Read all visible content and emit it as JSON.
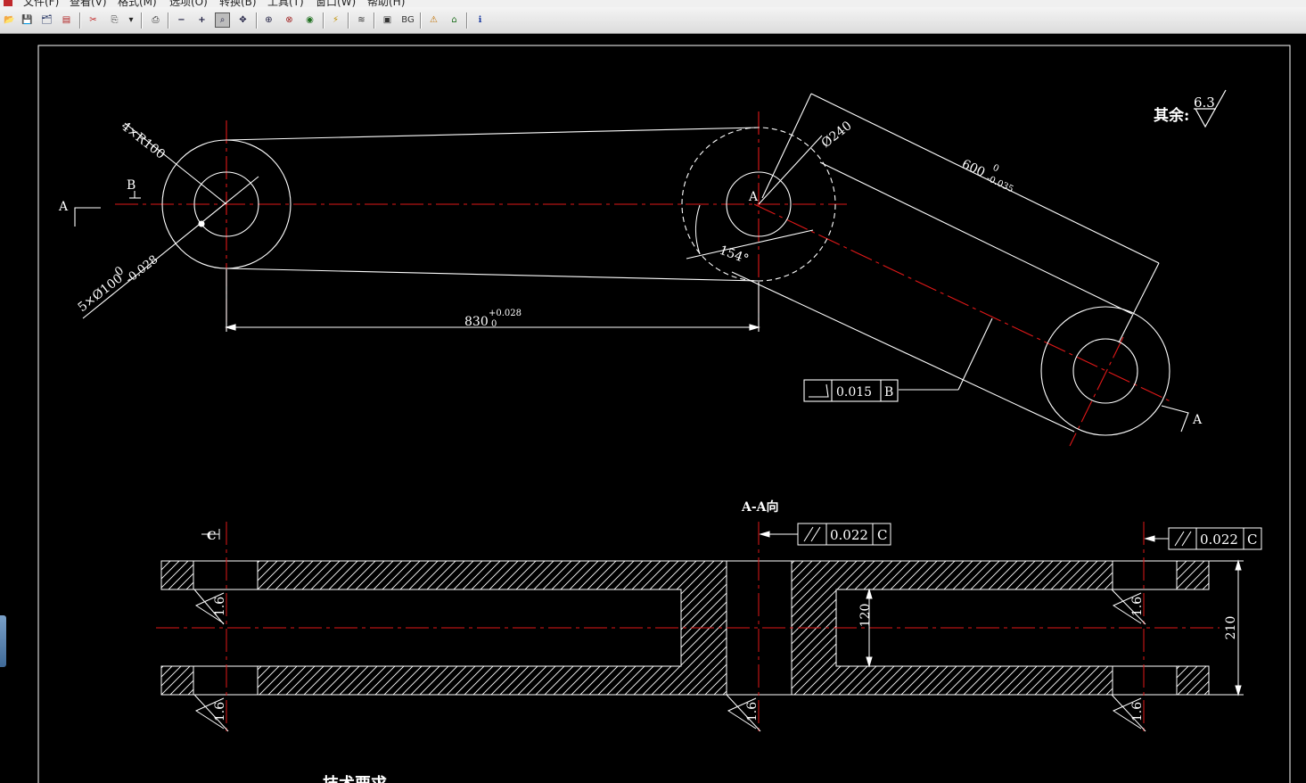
{
  "menu": {
    "items": [
      "文件(F)",
      "查看(V)",
      "格式(M)",
      "选项(O)",
      "转换(B)",
      "工具(T)",
      "窗口(W)",
      "帮助(H)"
    ]
  },
  "toolbar": {
    "buttons": [
      {
        "name": "open-icon",
        "glyph": "📂"
      },
      {
        "name": "save-icon",
        "glyph": "💾"
      },
      {
        "name": "save-all-icon",
        "glyph": "🗂"
      },
      {
        "name": "export-icon",
        "glyph": "▤"
      },
      {
        "name": "pdf-icon",
        "glyph": "✂"
      },
      {
        "name": "copy-icon",
        "glyph": "⎘"
      },
      {
        "name": "dropdown-arrow-icon",
        "glyph": "▾"
      },
      {
        "name": "print-icon",
        "glyph": "⎙"
      },
      {
        "name": "zoom-out-icon",
        "glyph": "−"
      },
      {
        "name": "zoom-in-icon",
        "glyph": "+"
      },
      {
        "name": "zoom-window-icon",
        "glyph": "⌕"
      },
      {
        "name": "pan-icon",
        "glyph": "✥"
      },
      {
        "name": "zoom-extents-icon",
        "glyph": "⊕"
      },
      {
        "name": "zoom-realtime-icon",
        "glyph": "⊗"
      },
      {
        "name": "eye-icon",
        "glyph": "◉"
      },
      {
        "name": "lightning-icon",
        "glyph": "⚡"
      },
      {
        "name": "layers-icon",
        "glyph": "≋"
      },
      {
        "name": "frame-icon",
        "glyph": "▣"
      },
      {
        "name": "bg-icon",
        "glyph": "BG"
      },
      {
        "name": "warning-icon",
        "glyph": "⚠"
      },
      {
        "name": "home-icon",
        "glyph": "⌂"
      },
      {
        "name": "info-icon",
        "glyph": "ℹ"
      }
    ]
  },
  "drawing": {
    "other_surface_label": "其余:",
    "other_surface_value": "6.3",
    "top_view": {
      "radius_label": "4×R100",
      "datum_b": "B",
      "section_a_left": "A",
      "hole_dia_label": "5×Ø100",
      "hole_dia_tol_upper": "0",
      "hole_dia_tol_lower": "-0.028",
      "dim_830": "830",
      "dim_830_upper": "+0.028",
      "dim_830_lower": "0",
      "center_a": "A",
      "dia_240": "Ø240",
      "angle_154": "154°",
      "dim_600": "600",
      "dim_600_upper": "0",
      "dim_600_lower": "-0.035",
      "fcf_angularity_value": "0.015",
      "fcf_angularity_datum": "B",
      "section_a_right": "A"
    },
    "section_view": {
      "title": "A-A向",
      "datum_c": "C",
      "fcf_parallel_1_value": "0.022",
      "fcf_parallel_1_datum": "C",
      "fcf_parallel_2_value": "0.022",
      "fcf_parallel_2_datum": "C",
      "dim_120": "120",
      "dim_210": "210",
      "roughness": "1.6"
    },
    "tech_requirements": "技术要求"
  }
}
